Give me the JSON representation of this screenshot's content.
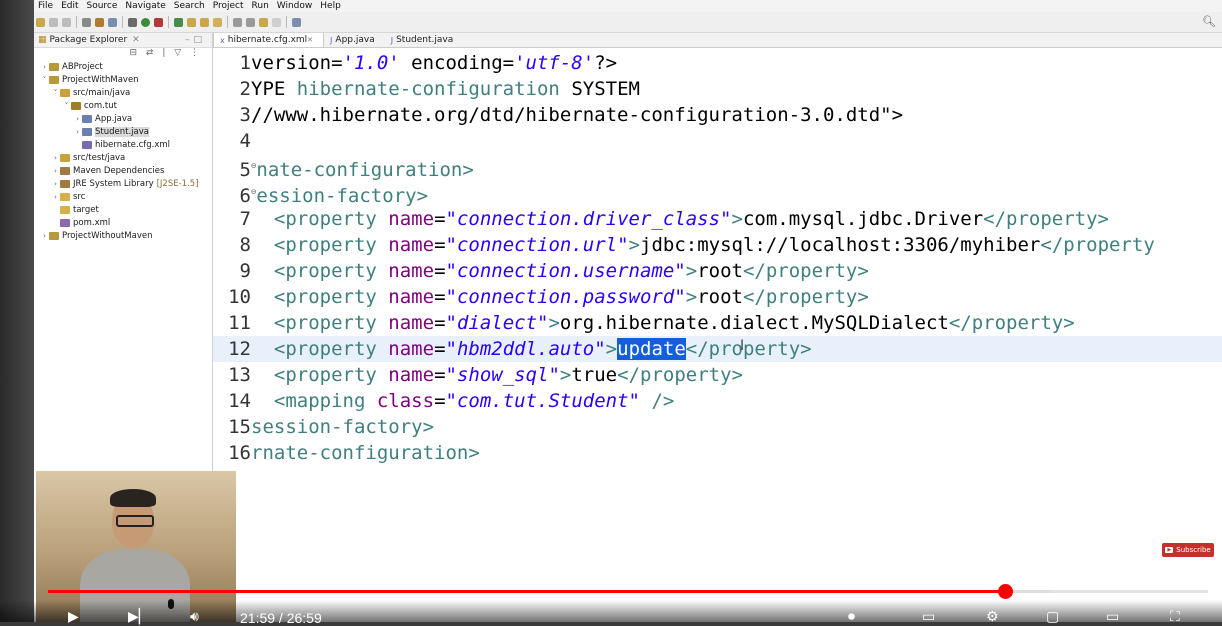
{
  "menu": [
    "File",
    "Edit",
    "Source",
    "Navigate",
    "Search",
    "Project",
    "Run",
    "Window",
    "Help"
  ],
  "package_explorer": {
    "title": "Package Explorer",
    "tree": [
      {
        "label": "ABProject",
        "depth": 0,
        "arrow": ">",
        "icon": "#b79a3b",
        "selected": false
      },
      {
        "label": "ProjectWithMaven",
        "depth": 0,
        "arrow": "v",
        "icon": "#b79a3b",
        "selected": false
      },
      {
        "label": "src/main/java",
        "depth": 1,
        "arrow": "v",
        "icon": "#c8a23c",
        "selected": false
      },
      {
        "label": "com.tut",
        "depth": 2,
        "arrow": "v",
        "icon": "#9f7d2a",
        "selected": false
      },
      {
        "label": "App.java",
        "depth": 3,
        "arrow": ">",
        "icon": "#6b7fb0",
        "selected": false
      },
      {
        "label": "Student.java",
        "depth": 3,
        "arrow": ">",
        "icon": "#6b7fb0",
        "selected": true
      },
      {
        "label": "hibernate.cfg.xml",
        "depth": 3,
        "arrow": "",
        "icon": "#7a6bb0",
        "selected": false
      },
      {
        "label": "src/test/java",
        "depth": 1,
        "arrow": ">",
        "icon": "#c8a23c",
        "selected": false
      },
      {
        "label": "Maven Dependencies",
        "depth": 1,
        "arrow": ">",
        "icon": "#a07a40",
        "selected": false
      },
      {
        "label": "JRE System Library",
        "depth": 1,
        "arrow": ">",
        "icon": "#a07a40",
        "selected": false,
        "extra": "[J2SE-1.5]"
      },
      {
        "label": "src",
        "depth": 1,
        "arrow": ">",
        "icon": "#d6b048",
        "selected": false
      },
      {
        "label": "target",
        "depth": 1,
        "arrow": "",
        "icon": "#d6b048",
        "selected": false
      },
      {
        "label": "pom.xml",
        "depth": 1,
        "arrow": "",
        "icon": "#8b6bb0",
        "selected": false
      },
      {
        "label": "ProjectWithoutMaven",
        "depth": 0,
        "arrow": ">",
        "icon": "#b79a3b",
        "selected": false
      }
    ]
  },
  "editor_tabs": [
    {
      "label": "hibernate.cfg.xml",
      "active": true
    },
    {
      "label": "App.java",
      "active": false
    },
    {
      "label": "Student.java",
      "active": false
    }
  ],
  "code_lines": [
    {
      "n": "1",
      "html": "version=<span class='av'>'1.0'</span> encoding=<span class='av'>'utf-8'</span>?>"
    },
    {
      "n": "2",
      "html": "YPE <span class='tg'>hibernate-configuration</span> SYSTEM"
    },
    {
      "n": "3",
      "html": "//www.hibernate.org/dtd/hibernate-configuration-3.0.dtd\">"
    },
    {
      "n": "4",
      "html": ""
    },
    {
      "n": "5",
      "html": "<span class='fold'>⊖</span><span class='tg'>nate-configuration&gt;</span>"
    },
    {
      "n": "6",
      "html": "<span class='fold'>⊖</span><span class='tg'>ession-factory&gt;</span>"
    },
    {
      "n": "7",
      "html": "  <span class='tg'>&lt;property</span> <span class='at'>name</span>=<span class='av'>\"connection.driver_class\"</span><span class='tg'>&gt;</span>com.mysql.jdbc.Driver<span class='tg'>&lt;/property&gt;</span>"
    },
    {
      "n": "8",
      "html": "  <span class='tg'>&lt;property</span> <span class='at'>name</span>=<span class='av'>\"connection.url\"</span><span class='tg'>&gt;</span>jdbc:mysql://localhost:3306/myhiber<span class='tg'>&lt;/property</span>"
    },
    {
      "n": "9",
      "html": "  <span class='tg'>&lt;property</span> <span class='at'>name</span>=<span class='av'>\"connection.username\"</span><span class='tg'>&gt;</span>root<span class='tg'>&lt;/property&gt;</span>"
    },
    {
      "n": "10",
      "html": "  <span class='tg'>&lt;property</span> <span class='at'>name</span>=<span class='av'>\"connection.password\"</span><span class='tg'>&gt;</span>root<span class='tg'>&lt;/property&gt;</span>"
    },
    {
      "n": "11",
      "html": "  <span class='tg'>&lt;property</span> <span class='at'>name</span>=<span class='av'>\"dialect\"</span><span class='tg'>&gt;</span>org.hibernate.dialect.MySQLDialect<span class='tg'>&lt;/property&gt;</span>"
    },
    {
      "n": "12",
      "html": "  <span class='tg'>&lt;property</span> <span class='at'>name</span>=<span class='av'>\"hbm2ddl.auto\"</span><span class='tg'>&gt;</span><span class='selword'>update</span><span class='tg'>&lt;/property&gt;</span>",
      "current": true
    },
    {
      "n": "13",
      "html": "  <span class='tg'>&lt;property</span> <span class='at'>name</span>=<span class='av'>\"show_sql\"</span><span class='tg'>&gt;</span>true<span class='tg'>&lt;/property&gt;</span>"
    },
    {
      "n": "14",
      "html": "  <span class='tg'>&lt;mapping</span> <span class='at'>class</span>=<span class='av'>\"com.tut.Student\"</span> <span class='tg'>/&gt;</span>"
    },
    {
      "n": "15",
      "html": "<span class='tg'>session-factory&gt;</span>"
    },
    {
      "n": "16",
      "html": "<span class='tg'>rnate-configuration&gt;</span>"
    }
  ],
  "video": {
    "time": "21:59 / 26:59",
    "progress": 0.825,
    "buffered": 0.865,
    "subscribe_label": "Subscribe",
    "accent": "#ff0000"
  }
}
